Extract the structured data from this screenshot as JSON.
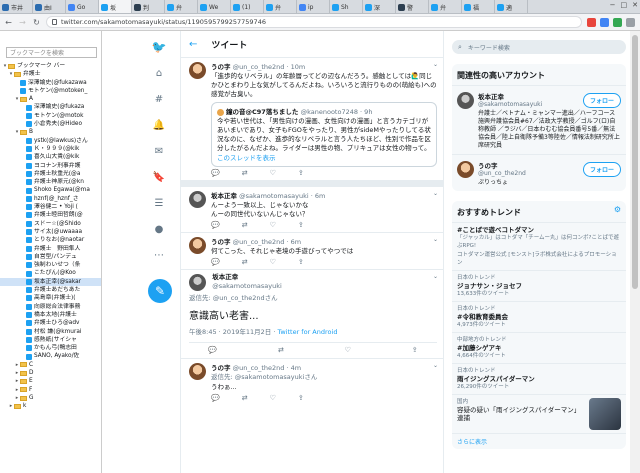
{
  "tabs": [
    {
      "label": "市井",
      "active": false,
      "color": "#2b6cb0"
    },
    {
      "label": "由I",
      "active": false,
      "color": "#2b6cb0"
    },
    {
      "label": "Go",
      "active": false,
      "color": "#4285f4"
    },
    {
      "label": "坂",
      "active": true,
      "color": "#1da1f2"
    },
    {
      "label": "判",
      "active": false,
      "color": "#2c3e50"
    },
    {
      "label": "弁",
      "active": false,
      "color": "#1da1f2"
    },
    {
      "label": "We",
      "active": false,
      "color": "#1da1f2"
    },
    {
      "label": "(1)",
      "active": false,
      "color": "#1da1f2"
    },
    {
      "label": "弁",
      "active": false,
      "color": "#1da1f2"
    },
    {
      "label": "ip",
      "active": false,
      "color": "#4285f4"
    },
    {
      "label": "Sh",
      "active": false,
      "color": "#1da1f2"
    },
    {
      "label": "深",
      "active": false,
      "color": "#1da1f2"
    },
    {
      "label": "警",
      "active": false,
      "color": "#2c3e50"
    },
    {
      "label": "弁",
      "active": false,
      "color": "#1da1f2"
    },
    {
      "label": "福",
      "active": false,
      "color": "#1da1f2"
    },
    {
      "label": "適",
      "active": false,
      "color": "#1da1f2"
    }
  ],
  "window_controls": [
    "−",
    "□",
    "✕"
  ],
  "address_bar": {
    "url": "twitter.com/sakamotomasayuki/status/1190595799257759746"
  },
  "sidebar": {
    "search_placeholder": "ブックマークを検索",
    "tree": [
      {
        "label": "ブックマーク バー",
        "indent": 1,
        "type": "folder",
        "twisty": "▾"
      },
      {
        "label": "弁護士",
        "indent": 2,
        "type": "folder",
        "twisty": "▾"
      },
      {
        "label": "深澤諭史(@fukazawa",
        "indent": 3,
        "type": "fav",
        "twisty": ""
      },
      {
        "label": "モトケン(@motoken_",
        "indent": 3,
        "type": "fav",
        "twisty": ""
      },
      {
        "label": "A",
        "indent": 3,
        "type": "folder",
        "twisty": "▾"
      },
      {
        "label": "深澤諭史(@fukaza",
        "indent": 4,
        "type": "fav",
        "twisty": ""
      },
      {
        "label": "モトケン(@motok",
        "indent": 4,
        "type": "fav",
        "twisty": ""
      },
      {
        "label": "小倉秀夫(@Hideo",
        "indent": 4,
        "type": "fav",
        "twisty": ""
      },
      {
        "label": "B",
        "indent": 3,
        "type": "folder",
        "twisty": "▾"
      },
      {
        "label": "ystk(@lawkus)さん",
        "indent": 4,
        "type": "fav",
        "twisty": ""
      },
      {
        "label": "Ｋ・９９９(@kik",
        "indent": 4,
        "type": "fav",
        "twisty": ""
      },
      {
        "label": "喜久山大貴(@kik",
        "indent": 4,
        "type": "fav",
        "twisty": ""
      },
      {
        "label": "ヨコナン刑事弁護",
        "indent": 4,
        "type": "fav",
        "twisty": ""
      },
      {
        "label": "弁護士秋重光(@a",
        "indent": 4,
        "type": "fav",
        "twisty": ""
      },
      {
        "label": "弁護士神原元(@kn",
        "indent": 4,
        "type": "fav",
        "twisty": ""
      },
      {
        "label": "Shoko Egawa(@ma",
        "indent": 4,
        "type": "fav",
        "twisty": ""
      },
      {
        "label": "hznf(@_hznf_さ",
        "indent": 4,
        "type": "fav",
        "twisty": ""
      },
      {
        "label": "澤谷健二 • Yoji (",
        "indent": 4,
        "type": "fav",
        "twisty": ""
      },
      {
        "label": "弁護士睦田哲朗(@",
        "indent": 4,
        "type": "fav",
        "twisty": ""
      },
      {
        "label": "スドー☆(@Shido",
        "indent": 4,
        "type": "fav",
        "twisty": ""
      },
      {
        "label": "サイ太(@uwaaaa",
        "indent": 4,
        "type": "fav",
        "twisty": ""
      },
      {
        "label": "とりなお(@naotar",
        "indent": 4,
        "type": "fav",
        "twisty": ""
      },
      {
        "label": "弁護士　野田隼人",
        "indent": 4,
        "type": "fav",
        "twisty": ""
      },
      {
        "label": "自営型/パンデュ",
        "indent": 4,
        "type": "fav",
        "twisty": ""
      },
      {
        "label": "強制わいせつ（条",
        "indent": 4,
        "type": "fav",
        "twisty": ""
      },
      {
        "label": "こたぴん(@Koo",
        "indent": 4,
        "type": "fav",
        "twisty": ""
      },
      {
        "label": "坂本正幸(@sakar",
        "indent": 4,
        "type": "fav",
        "twisty": "",
        "selected": true
      },
      {
        "label": "弁護士あだちあた",
        "indent": 4,
        "type": "fav",
        "twisty": ""
      },
      {
        "label": "高島章(弁護士)(",
        "indent": 4,
        "type": "fav",
        "twisty": ""
      },
      {
        "label": "向原総合法律事務",
        "indent": 4,
        "type": "fav",
        "twisty": ""
      },
      {
        "label": "橋本太地(弁護士",
        "indent": 4,
        "type": "fav",
        "twisty": ""
      },
      {
        "label": "弁護士ひろ@adv",
        "indent": 4,
        "type": "fav",
        "twisty": ""
      },
      {
        "label": "村松 謙(@kmurai",
        "indent": 4,
        "type": "fav",
        "twisty": ""
      },
      {
        "label": "感熱紙(サイシャ",
        "indent": 4,
        "type": "fav",
        "twisty": ""
      },
      {
        "label": "かもん弓(鴨志田",
        "indent": 4,
        "type": "fav",
        "twisty": ""
      },
      {
        "label": "SANO, Ayako/佐",
        "indent": 4,
        "type": "fav",
        "twisty": ""
      },
      {
        "label": "C",
        "indent": 3,
        "type": "folder",
        "twisty": "▸"
      },
      {
        "label": "D",
        "indent": 3,
        "type": "folder",
        "twisty": "▸"
      },
      {
        "label": "E",
        "indent": 3,
        "type": "folder",
        "twisty": "▸"
      },
      {
        "label": "F",
        "indent": 3,
        "type": "folder",
        "twisty": "▸"
      },
      {
        "label": "G",
        "indent": 3,
        "type": "folder",
        "twisty": "▸"
      },
      {
        "label": "k",
        "indent": 2,
        "type": "folder",
        "twisty": "▸"
      }
    ]
  },
  "nav_icons": [
    "bird-logo-icon",
    "home-icon",
    "explore-icon",
    "notifications-icon",
    "messages-icon",
    "bookmarks-icon",
    "lists-icon",
    "profile-icon",
    "more-icon"
  ],
  "main": {
    "header": "ツイート",
    "tweets": [
      {
        "name": "うの字",
        "handle": "@un_co_the2nd",
        "time": "10m",
        "body": "「進歩的なリベラル」の年齢層ってどの辺なんだろう。感触としては🙋‍♂️同じかひとまわり上な気がしてるんだよね。いろいろと流行りものの(萌絵も)への感覚が古臭い。",
        "avatar": "a1",
        "quote": {
          "name": "鐘の音@C97落ちました",
          "handle": "@kanenooto7248 · 9h",
          "body": "今や若い世代は、「男性向けの漫画、女性向けの漫画」と言うカテゴリがあいまいであり、女子もFGOをやったり、男性がsideMやったりしてる状況なのに、なぜか、進歩的なリベラルと言う人たちほど、性別で作品を区分したがるんだよね。ライダーは男性の物、プリキュアは女性の物って。",
          "thread_link": "このスレッドを表示"
        }
      },
      {
        "name": "坂本正幸",
        "handle": "@sakamotomasayuki",
        "time": "6m",
        "body": "んーよう一致以上、じゃないかな\nんーの同世代いないんじゃない？",
        "avatar": "a2"
      },
      {
        "name": "うの字",
        "handle": "@un_co_the2nd",
        "time": "6m",
        "body": "何てこった、それじゃ老境の手遊びってやつでは",
        "avatar": "a1"
      }
    ],
    "focused": {
      "name": "坂本正幸",
      "handle": "@sakamotomasayuki",
      "reply_to": "返信先: @un_co_the2ndさん",
      "body": "意識高い老害...",
      "time": "午後8:45 · 2019年11月2日",
      "source": "Twitter for Android"
    },
    "reply": {
      "name": "うの字",
      "handle": "@un_co_the2nd",
      "time": "4m",
      "reply_to": "返信先: @sakamotomasayukiさん",
      "body": "うわぁ..."
    }
  },
  "right": {
    "search_placeholder": "キーワード検索",
    "related_title": "関連性の高いアカウント",
    "accounts": [
      {
        "name": "坂本正幸",
        "handle": "@sakamotomasayuki",
        "follow": "フォロー",
        "bio": "弁護士／ベトナム・ミャンマー進出／ハーフコース施興弁護協会員#67／法政大学教授／ゴルフ(ロ)自称教師 ／ラジバ／日本わむむ協会員番号5番／無法協会員／陸上自衛隊予備3等陸佐／情報法制研究所上席研究員",
        "avatar": "a2"
      },
      {
        "name": "うの字",
        "handle": "@un_co_the2nd",
        "follow": "フォロー",
        "bio": "ぷりっちょ",
        "avatar": "a1"
      }
    ],
    "trends_title": "おすすめトレンド",
    "trends": [
      {
        "ctx": "",
        "name": "#ことばで遊べコトダマン",
        "desc": "「ジャッカル」はコトダマ「チームー丸」は何コンボ?ことばで遊ぶRPG!",
        "promo": "コトダマン運営公式 [モンスト]ラボ株式会社によるプロモーション",
        "count": ""
      },
      {
        "ctx": "日本のトレンド",
        "name": "ジョナサン・ジョセフ",
        "desc": "",
        "promo": "",
        "count": "13,633件のツイート"
      },
      {
        "ctx": "日本のトレンド",
        "name": "#令和教育委員会",
        "desc": "",
        "promo": "",
        "count": "4,973件のツイート"
      },
      {
        "ctx": "中部地方のトレンド",
        "name": "#加藤シゲアキ",
        "desc": "",
        "promo": "",
        "count": "4,664件のツイート"
      },
      {
        "ctx": "日本のトレンド",
        "name": "雨イジングスパイダーマン",
        "desc": "",
        "promo": "",
        "count": "26,290件のツイート"
      }
    ],
    "news": {
      "ctx": "国内",
      "title": "容疑の疑い「雨イジングスパイダーマン」連捕"
    },
    "more": "さらに表示"
  }
}
